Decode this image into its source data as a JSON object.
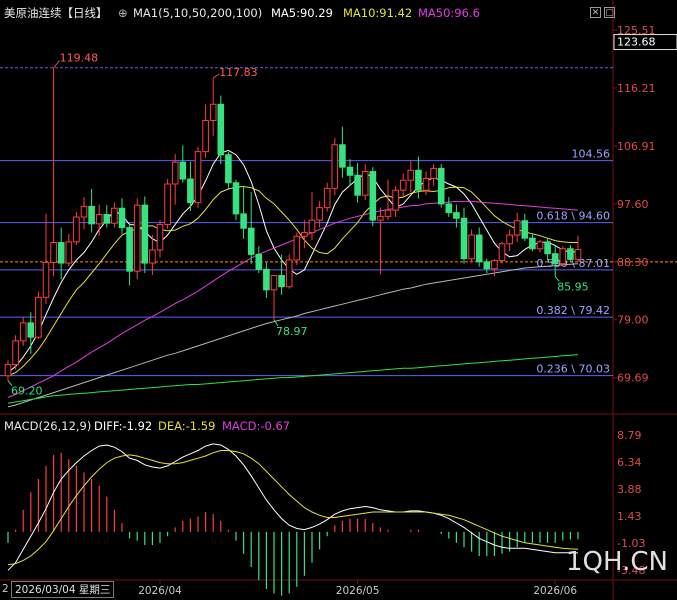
{
  "header": {
    "symbol": "美原油连续",
    "period": "【日线】",
    "ma_label": "MA1(5,10,50,200,100)",
    "ma5": "MA5:90.29",
    "ma10": "MA10:91.42",
    "ma50": "MA50:96.6"
  },
  "macd_header": {
    "label": "MACD(26,12,9)",
    "diff": "DIFF:-1.92",
    "dea": "DEA:-1.59",
    "macd": "MACD:-0.67"
  },
  "footer": {
    "cursor_date": "2026/03/04 星期三",
    "edge_char": "2"
  },
  "watermark": "1QH.CN",
  "colors": {
    "bg": "#000000",
    "up": "#ff3c3c",
    "down": "#35e27f",
    "ma5": "#ffffff",
    "ma10": "#e8e03a",
    "ma50": "#e23de0",
    "ma_slow": "#b4b4b4",
    "ma_slowest": "#2fe04a",
    "fib": "#5a62ff",
    "fib_text": "#9aa4ff",
    "price_line": "#ff8a1e",
    "axis_text": "#e04a4a"
  },
  "chart_data": [
    {
      "type": "candlestick",
      "title": "美原油连续 【日线】",
      "ylim": [
        64.5,
        127.3
      ],
      "y_ticks": [
        "125.51",
        "116.21",
        "106.91",
        "97.60",
        "88.30",
        "79.00",
        "69.69"
      ],
      "current_price": "123.68",
      "x_labels": [
        "2026/04",
        "2026/05",
        "2026/06"
      ],
      "annotations": [
        "119.48",
        "117.83",
        "78.97",
        "69.20",
        "85.95"
      ],
      "fib_levels": [
        {
          "value": 104.56,
          "label": "104.56"
        },
        {
          "value": 94.6,
          "label": "0.618 \\ 94.60"
        },
        {
          "value": 87.01,
          "label": "0.500 \\ 87.01"
        },
        {
          "value": 79.42,
          "label": "0.382 \\ 79.42"
        },
        {
          "value": 70.03,
          "label": "0.236 \\ 70.03"
        }
      ],
      "reference_lines": [
        119.48,
        88.3
      ],
      "candles": [
        [
          70.0,
          72.5,
          69.2,
          71.8
        ],
        [
          71.8,
          76.5,
          71.0,
          75.6
        ],
        [
          75.6,
          79.4,
          74.8,
          78.5
        ],
        [
          78.5,
          80.2,
          73.5,
          76.2
        ],
        [
          76.2,
          83.5,
          75.9,
          82.6
        ],
        [
          82.6,
          96.0,
          81.5,
          88.2
        ],
        [
          88.2,
          119.48,
          86.0,
          91.4
        ],
        [
          91.4,
          93.8,
          85.5,
          88.1
        ],
        [
          88.1,
          92.8,
          87.6,
          91.5
        ],
        [
          91.5,
          96.3,
          91.0,
          95.5
        ],
        [
          95.5,
          98.7,
          93.5,
          97.2
        ],
        [
          97.2,
          100.0,
          93.0,
          94.4
        ],
        [
          94.4,
          97.5,
          92.5,
          95.9
        ],
        [
          95.9,
          97.4,
          93.8,
          94.5
        ],
        [
          94.5,
          97.8,
          93.8,
          96.9
        ],
        [
          96.9,
          98.5,
          92.8,
          93.8
        ],
        [
          93.8,
          94.5,
          84.5,
          86.8
        ],
        [
          86.8,
          98.5,
          85.5,
          97.4
        ],
        [
          97.4,
          98.8,
          86.5,
          88.1
        ],
        [
          88.1,
          92.6,
          86.2,
          90.2
        ],
        [
          90.2,
          95.0,
          89.0,
          94.3
        ],
        [
          94.3,
          101.6,
          93.6,
          100.8
        ],
        [
          100.8,
          105.6,
          97.5,
          104.3
        ],
        [
          104.3,
          107.0,
          101.0,
          101.6
        ],
        [
          101.6,
          104.4,
          96.5,
          97.8
        ],
        [
          97.8,
          106.8,
          97.0,
          106.0
        ],
        [
          106.0,
          113.6,
          105.0,
          111.0
        ],
        [
          111.0,
          117.83,
          108.5,
          113.6
        ],
        [
          113.6,
          115.0,
          104.0,
          105.5
        ],
        [
          105.5,
          105.9,
          100.0,
          101.0
        ],
        [
          101.0,
          101.5,
          95.0,
          96.0
        ],
        [
          96.0,
          100.5,
          92.0,
          93.7
        ],
        [
          93.7,
          99.5,
          88.0,
          89.5
        ],
        [
          89.5,
          90.8,
          86.5,
          87.1
        ],
        [
          87.1,
          88.2,
          82.5,
          83.8
        ],
        [
          83.8,
          86.1,
          78.97,
          86.1
        ],
        [
          86.1,
          89.5,
          83.0,
          84.3
        ],
        [
          84.3,
          89.5,
          84.0,
          88.6
        ],
        [
          88.6,
          93.0,
          87.8,
          92.4
        ],
        [
          92.4,
          95.0,
          90.5,
          93.0
        ],
        [
          93.0,
          99.5,
          91.8,
          95.0
        ],
        [
          95.0,
          98.0,
          93.8,
          97.0
        ],
        [
          97.0,
          101.0,
          96.4,
          100.1
        ],
        [
          100.1,
          108.2,
          99.0,
          107.1
        ],
        [
          107.1,
          110.0,
          101.8,
          103.5
        ],
        [
          103.5,
          104.8,
          100.5,
          102.2
        ],
        [
          102.2,
          104.2,
          97.8,
          99.0
        ],
        [
          99.0,
          104.0,
          98.2,
          102.8
        ],
        [
          102.8,
          103.5,
          94.0,
          95.0
        ],
        [
          95.0,
          97.0,
          86.3,
          95.6
        ],
        [
          95.6,
          101.5,
          95.0,
          96.6
        ],
        [
          96.6,
          100.5,
          95.5,
          99.8
        ],
        [
          99.8,
          102.5,
          98.8,
          101.4
        ],
        [
          101.4,
          104.6,
          99.5,
          103.0
        ],
        [
          103.0,
          105.2,
          98.5,
          99.8
        ],
        [
          99.8,
          102.8,
          99.0,
          101.7
        ],
        [
          101.7,
          104.0,
          100.5,
          103.3
        ],
        [
          103.3,
          104.0,
          97.0,
          97.6
        ],
        [
          97.6,
          98.7,
          95.5,
          96.2
        ],
        [
          96.2,
          97.5,
          93.8,
          95.3
        ],
        [
          95.3,
          97.0,
          88.0,
          88.8
        ],
        [
          88.8,
          93.5,
          88.2,
          92.6
        ],
        [
          92.6,
          93.8,
          87.5,
          88.3
        ],
        [
          88.3,
          88.8,
          86.5,
          87.2
        ],
        [
          87.2,
          88.7,
          86.0,
          88.5
        ],
        [
          88.5,
          91.5,
          88.0,
          91.2
        ],
        [
          91.2,
          93.5,
          90.0,
          92.6
        ],
        [
          92.6,
          96.2,
          91.5,
          94.9
        ],
        [
          94.9,
          96.0,
          91.6,
          92.1
        ],
        [
          92.1,
          92.8,
          90.0,
          90.4
        ],
        [
          90.4,
          91.8,
          89.8,
          91.5
        ],
        [
          91.5,
          92.0,
          88.5,
          89.6
        ],
        [
          89.6,
          90.8,
          85.95,
          88.0
        ],
        [
          88.0,
          90.8,
          87.5,
          90.4
        ],
        [
          90.4,
          91.0,
          88.3,
          88.7
        ],
        [
          88.7,
          92.5,
          88.3,
          90.29
        ]
      ],
      "ma_series": {
        "MA5": [
          70.5,
          71.5,
          73.0,
          74.8,
          77.0,
          79.8,
          82.5,
          85.0,
          87.0,
          88.6,
          89.8,
          91.5,
          93.5,
          95.0,
          96.5,
          95.8,
          94.3,
          94.2,
          93.1,
          92.0,
          91.4,
          92.6,
          94.3,
          96.0,
          97.2,
          98.9,
          101.3,
          104.0,
          105.8,
          106.2,
          105.5,
          103.9,
          101.2,
          97.5,
          93.3,
          90.5,
          88.6,
          87.1,
          86.3,
          87.0,
          89.5,
          92.0,
          94.5,
          97.5,
          99.5,
          100.6,
          101.6,
          102.5,
          101.9,
          100.0,
          98.5,
          97.0,
          97.6,
          99.0,
          100.4,
          101.3,
          101.8,
          101.4,
          100.8,
          100.3,
          99.2,
          97.6,
          95.5,
          93.4,
          91.3,
          89.9,
          89.1,
          89.3,
          90.3,
          91.0,
          91.4,
          91.5,
          90.9,
          90.2,
          89.8,
          90.0
        ],
        "MA10": [
          70.0,
          70.5,
          71.5,
          72.8,
          74.2,
          76.0,
          78.0,
          80.0,
          82.0,
          83.8,
          85.0,
          86.5,
          88.0,
          89.6,
          91.2,
          92.6,
          93.2,
          93.6,
          94.0,
          94.1,
          93.5,
          93.3,
          93.4,
          94.0,
          94.4,
          95.3,
          96.7,
          98.3,
          99.5,
          100.0,
          100.3,
          100.4,
          100.2,
          99.7,
          98.5,
          97.6,
          96.3,
          95.0,
          93.5,
          91.8,
          90.5,
          89.8,
          89.6,
          90.5,
          92.0,
          93.3,
          94.6,
          96.3,
          97.5,
          98.6,
          98.9,
          98.5,
          98.7,
          99.3,
          99.6,
          99.7,
          99.6,
          99.8,
          100.2,
          100.3,
          100.2,
          99.5,
          98.3,
          97.0,
          95.7,
          94.8,
          94.1,
          93.5,
          93.1,
          92.8,
          92.5,
          92.1,
          91.7,
          91.5,
          91.4,
          91.4
        ],
        "MA50": [
          66.5,
          67.0,
          67.6,
          68.2,
          68.8,
          69.4,
          70.0,
          70.8,
          71.5,
          72.2,
          73.0,
          73.8,
          74.5,
          75.2,
          76.0,
          76.8,
          77.5,
          78.2,
          78.9,
          79.5,
          80.2,
          80.9,
          81.6,
          82.2,
          82.9,
          83.6,
          84.4,
          85.2,
          86.0,
          86.8,
          87.5,
          88.2,
          88.9,
          89.5,
          90.0,
          90.5,
          91.0,
          91.5,
          92.0,
          92.5,
          93.0,
          93.5,
          94.0,
          94.5,
          94.9,
          95.3,
          95.6,
          95.9,
          96.2,
          96.5,
          96.7,
          96.9,
          97.1,
          97.3,
          97.4,
          97.6,
          97.7,
          97.8,
          97.9,
          98.0,
          98.0,
          98.0,
          97.9,
          97.8,
          97.7,
          97.6,
          97.5,
          97.4,
          97.3,
          97.2,
          97.1,
          97.0,
          96.9,
          96.8,
          96.7,
          96.6
        ],
        "MA_slow": [
          65.0,
          65.3,
          65.7,
          66.1,
          66.5,
          66.9,
          67.3,
          67.7,
          68.1,
          68.5,
          68.9,
          69.3,
          69.7,
          70.1,
          70.5,
          70.9,
          71.3,
          71.7,
          72.1,
          72.5,
          72.9,
          73.3,
          73.6,
          74.0,
          74.4,
          74.8,
          75.2,
          75.6,
          76.0,
          76.4,
          76.8,
          77.2,
          77.6,
          78.0,
          78.4,
          78.7,
          79.0,
          79.3,
          79.6,
          80.0,
          80.3,
          80.6,
          80.9,
          81.2,
          81.5,
          81.8,
          82.1,
          82.4,
          82.7,
          83.0,
          83.3,
          83.6,
          83.9,
          84.1,
          84.4,
          84.7,
          84.9,
          85.1,
          85.3,
          85.5,
          85.7,
          85.9,
          86.1,
          86.3,
          86.5,
          86.7,
          86.9,
          87.1,
          87.3,
          87.4,
          87.5,
          87.6,
          87.7,
          87.8,
          87.9,
          88.0
        ],
        "MA_slowest": [
          65.6,
          65.8,
          66.0,
          66.2,
          66.4,
          66.6,
          66.8,
          66.9,
          67.0,
          67.1,
          67.2,
          67.3,
          67.4,
          67.5,
          67.6,
          67.7,
          67.8,
          67.9,
          68.0,
          68.1,
          68.2,
          68.3,
          68.4,
          68.5,
          68.6,
          68.6,
          68.7,
          68.8,
          68.9,
          69.0,
          69.1,
          69.2,
          69.3,
          69.4,
          69.5,
          69.6,
          69.7,
          69.7,
          69.8,
          69.9,
          70.0,
          70.1,
          70.2,
          70.3,
          70.4,
          70.5,
          70.6,
          70.7,
          70.8,
          70.9,
          71.0,
          71.1,
          71.2,
          71.2,
          71.3,
          71.4,
          71.5,
          71.6,
          71.7,
          71.8,
          71.9,
          72.0,
          72.1,
          72.2,
          72.3,
          72.4,
          72.5,
          72.6,
          72.7,
          72.8,
          72.9,
          73.0,
          73.1,
          73.2,
          73.3,
          73.4
        ]
      }
    },
    {
      "type": "macd",
      "title": "MACD(26,12,9)",
      "ylim": [
        -4.2,
        8.9
      ],
      "y_ticks": [
        "8.79",
        "6.34",
        "3.88",
        "1.43",
        "-1.03",
        "-3.48"
      ],
      "diff": [
        -3.5,
        -2.8,
        -1.6,
        -0.4,
        0.8,
        2.1,
        3.6,
        4.8,
        5.6,
        6.3,
        6.9,
        7.4,
        7.8,
        7.9,
        7.7,
        7.3,
        6.7,
        6.5,
        6.1,
        5.9,
        5.8,
        6.0,
        6.4,
        6.8,
        7.1,
        7.4,
        7.8,
        8.0,
        7.9,
        7.5,
        6.9,
        6.1,
        5.1,
        4.0,
        2.9,
        2.0,
        1.2,
        0.6,
        0.3,
        0.2,
        0.4,
        0.7,
        1.1,
        1.6,
        1.9,
        2.1,
        2.2,
        2.3,
        2.2,
        2.0,
        1.9,
        1.8,
        1.8,
        1.9,
        1.9,
        1.8,
        1.7,
        1.5,
        1.2,
        0.8,
        0.4,
        -0.1,
        -0.6,
        -0.9,
        -1.2,
        -1.4,
        -1.5,
        -1.5,
        -1.5,
        -1.6,
        -1.7,
        -1.8,
        -1.9,
        -1.9,
        -1.9,
        -1.92
      ],
      "dea": [
        -3.0,
        -2.9,
        -2.6,
        -2.2,
        -1.6,
        -0.9,
        0.1,
        1.2,
        2.3,
        3.3,
        4.2,
        5.0,
        5.7,
        6.3,
        6.7,
        6.9,
        7.0,
        6.9,
        6.7,
        6.5,
        6.3,
        6.2,
        6.2,
        6.3,
        6.5,
        6.7,
        6.9,
        7.2,
        7.4,
        7.4,
        7.3,
        7.1,
        6.7,
        6.2,
        5.5,
        4.8,
        4.1,
        3.4,
        2.8,
        2.2,
        1.8,
        1.5,
        1.3,
        1.3,
        1.4,
        1.5,
        1.6,
        1.7,
        1.8,
        1.8,
        1.8,
        1.8,
        1.8,
        1.8,
        1.8,
        1.8,
        1.7,
        1.6,
        1.5,
        1.3,
        1.1,
        0.8,
        0.5,
        0.2,
        -0.1,
        -0.4,
        -0.6,
        -0.8,
        -1.0,
        -1.1,
        -1.2,
        -1.3,
        -1.4,
        -1.5,
        -1.55,
        -1.59
      ],
      "histogram": [
        -1.0,
        0.2,
        2.0,
        3.6,
        4.8,
        6.0,
        7.0,
        7.2,
        6.6,
        6.0,
        5.4,
        4.8,
        4.2,
        3.2,
        2.0,
        0.8,
        -0.6,
        -0.8,
        -1.2,
        -1.2,
        -1.0,
        -0.4,
        0.4,
        1.0,
        1.2,
        1.4,
        1.8,
        1.6,
        1.0,
        0.2,
        -0.8,
        -2.0,
        -3.2,
        -4.4,
        -5.2,
        -5.6,
        -5.8,
        -5.6,
        -5.0,
        -4.0,
        -2.8,
        -1.6,
        -0.4,
        0.6,
        1.0,
        1.2,
        1.2,
        1.2,
        0.8,
        0.4,
        0.2,
        0.0,
        0.0,
        0.2,
        0.2,
        0.0,
        0.0,
        -0.2,
        -0.6,
        -1.0,
        -1.4,
        -1.8,
        -2.2,
        -2.2,
        -2.2,
        -2.0,
        -1.8,
        -1.4,
        -1.0,
        -1.0,
        -1.0,
        -1.0,
        -1.0,
        -0.8,
        -0.7,
        -0.67
      ]
    }
  ]
}
